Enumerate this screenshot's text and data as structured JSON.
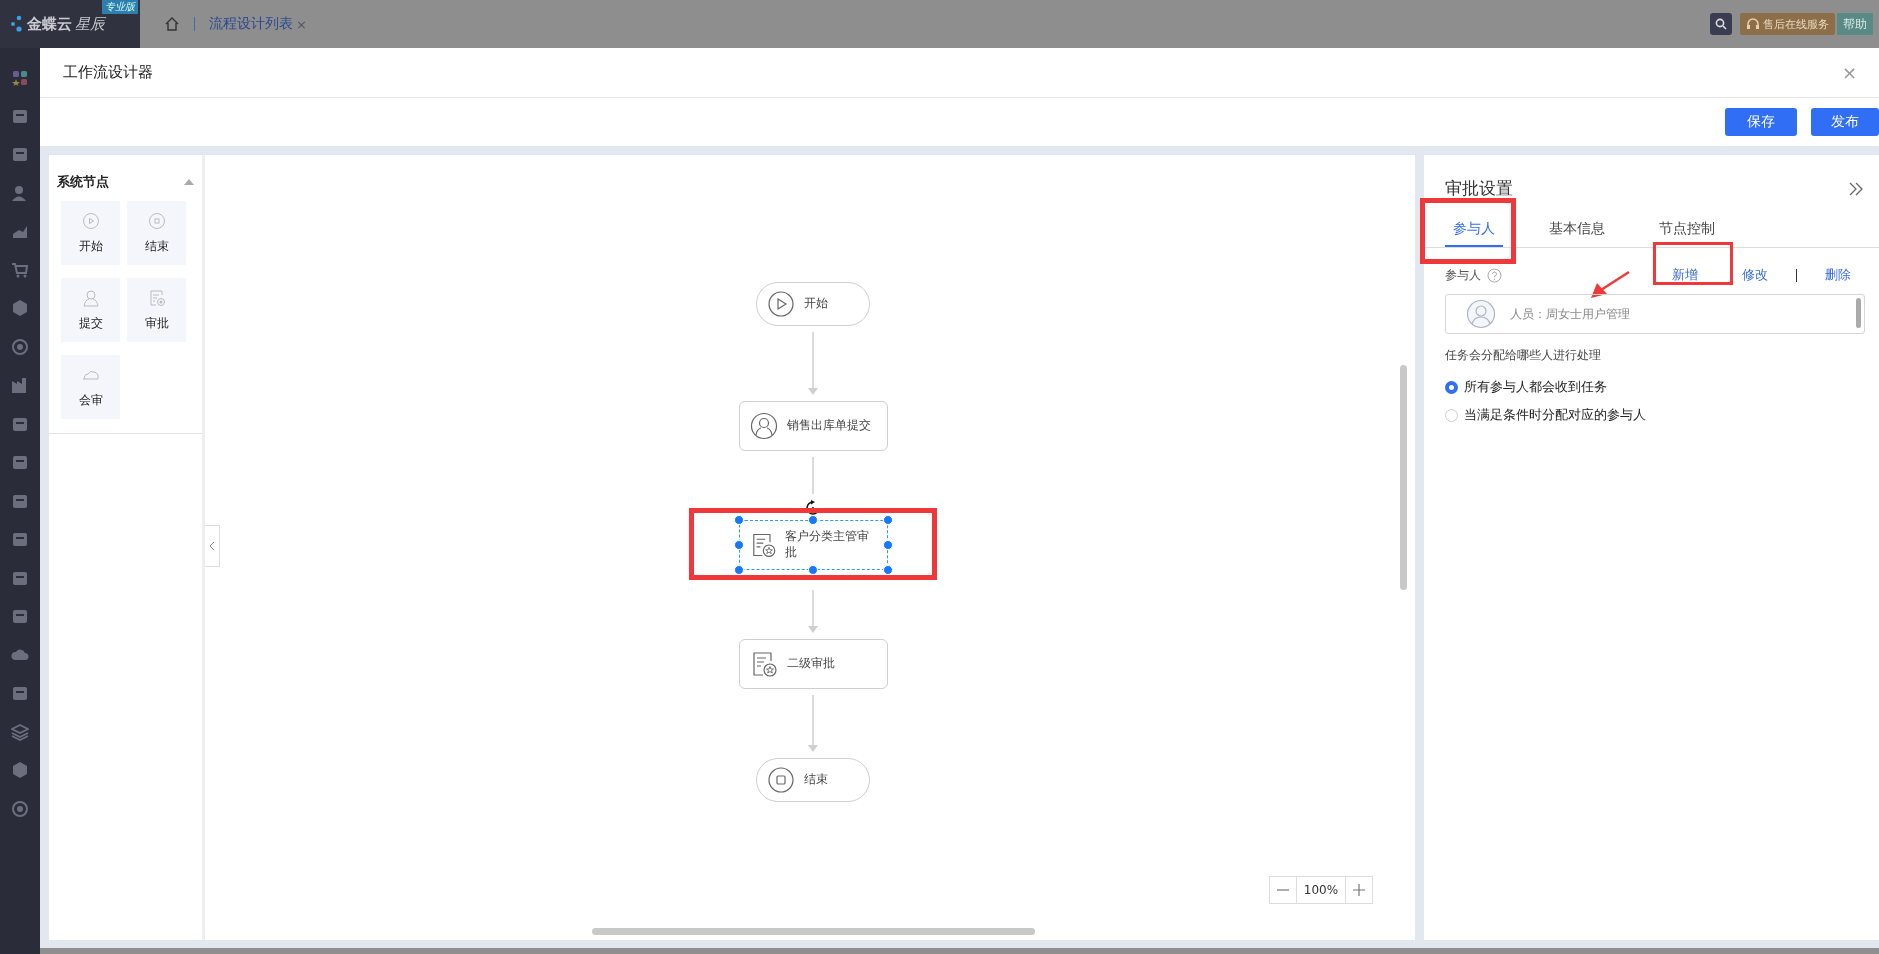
{
  "top_bar": {
    "logo": "金蝶云",
    "logo_suffix": "星辰",
    "edition_badge": "专业版",
    "tabs": [
      {
        "label": "流程设计列表",
        "selected": true
      }
    ],
    "tab_close": "×",
    "service_button": "售后在线服务",
    "help_button": "帮助"
  },
  "dialog": {
    "title": "工作流设计器",
    "close": "×",
    "buttons": [
      {
        "label": "保存"
      },
      {
        "label": "发布"
      }
    ]
  },
  "palette": {
    "title": "系统节点",
    "expanded": true,
    "items": [
      {
        "kind": "start",
        "label": "开始"
      },
      {
        "kind": "end",
        "label": "结束"
      },
      {
        "kind": "submit",
        "label": "提交"
      },
      {
        "kind": "approval",
        "label": "审批"
      },
      {
        "kind": "cosign",
        "label": "会审"
      }
    ]
  },
  "canvas": {
    "nodes": [
      {
        "kind": "start",
        "label": "开始",
        "selected": false
      },
      {
        "kind": "submit",
        "label": "销售出库单提交",
        "selected": false
      },
      {
        "kind": "approval",
        "label": "客户分类主管审批",
        "selected": true
      },
      {
        "kind": "approval",
        "label": "二级审批",
        "selected": false
      },
      {
        "kind": "end",
        "label": "结束",
        "selected": false
      }
    ],
    "zoom": "100%"
  },
  "settings": {
    "title": "审批设置",
    "tabs": [
      {
        "label": "参与人",
        "selected": true
      },
      {
        "label": "基本信息",
        "selected": false
      },
      {
        "label": "节点控制",
        "selected": false
      }
    ],
    "participants_label": "参与人",
    "actions": [
      "新增",
      "修改",
      "删除"
    ],
    "participants": [
      "人员：周女士用户管理"
    ],
    "hint": "任务会分配给哪些人进行处理",
    "options": [
      {
        "label": "所有参与人都会收到任务",
        "selected": true
      },
      {
        "label": "当满足条件时分配对应的参与人",
        "selected": false
      }
    ]
  }
}
